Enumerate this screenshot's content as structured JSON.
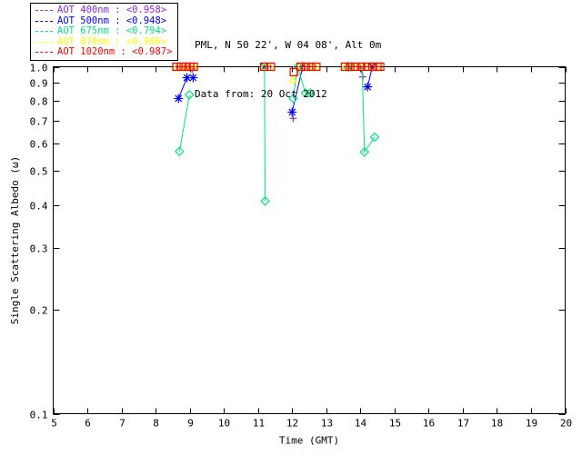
{
  "header": {
    "line1": "PML, N 50 22', W 04 08', Alt 0m",
    "line2": "Data from: 20 Oct 2012"
  },
  "legend": {
    "position": "top-left",
    "entries": [
      {
        "label": "AOT  400nm : <0.958>",
        "wavelength": "400nm",
        "mean": "<0.958>",
        "color": "#8a2be2"
      },
      {
        "label": "AOT  500nm : <0.948>",
        "wavelength": "500nm",
        "mean": "<0.948>",
        "color": "#0000ff"
      },
      {
        "label": "AOT  675nm : <0.794>",
        "wavelength": "675nm",
        "mean": "<0.794>",
        "color": "#00e67c"
      },
      {
        "label": "AOT  870nm : <0.986>",
        "wavelength": "870nm",
        "mean": "<0.986>",
        "color": "#ffff00"
      },
      {
        "label": "AOT 1020nm : <0.987>",
        "wavelength": "1020nm",
        "mean": "<0.987>",
        "color": "#ff0000"
      }
    ]
  },
  "chart_data": {
    "type": "scatter",
    "title": "",
    "xlabel": "Time (GMT)",
    "ylabel": "Single Scattering Albedo (ω)",
    "xlim": [
      5,
      20
    ],
    "ylim": [
      0.1,
      1.0
    ],
    "y_scale": "log",
    "grid": false,
    "x_ticks": [
      5,
      6,
      7,
      8,
      9,
      10,
      11,
      12,
      13,
      14,
      15,
      16,
      17,
      18,
      19,
      20
    ],
    "y_ticks": [
      0.1,
      0.2,
      0.3,
      0.4,
      0.5,
      0.6,
      0.7,
      0.8,
      0.9,
      1.0
    ],
    "axis_color": "#000000",
    "series": [
      {
        "name": "AOT 400nm",
        "color": "#8a2be2",
        "marker": "plus",
        "mean_ssa": 0.958,
        "runs": [
          [
            [
              8.62,
              1.0
            ],
            [
              8.77,
              1.0
            ],
            [
              8.91,
              1.0
            ],
            [
              9.07,
              0.985
            ]
          ],
          [
            [
              11.18,
              1.0
            ],
            [
              11.37,
              1.0
            ]
          ],
          [
            [
              12.3,
              1.0
            ],
            [
              12.45,
              1.0
            ],
            [
              12.6,
              1.0
            ]
          ],
          [
            [
              12.03,
              0.71
            ]
          ],
          [
            [
              13.6,
              1.0
            ],
            [
              13.75,
              1.0
            ]
          ],
          [
            [
              14.0,
              1.0
            ],
            [
              14.04,
              0.978
            ],
            [
              14.07,
              0.935
            ]
          ],
          [
            [
              14.3,
              1.0
            ],
            [
              14.45,
              1.0
            ]
          ]
        ]
      },
      {
        "name": "AOT 500nm",
        "color": "#0000ff",
        "marker": "asterisk",
        "mean_ssa": 0.948,
        "runs": [
          [
            [
              8.67,
              0.81
            ],
            [
              8.92,
              0.93
            ],
            [
              9.1,
              0.93
            ]
          ],
          [
            [
              11.19,
              1.0
            ]
          ],
          [
            [
              12.0,
              0.74
            ],
            [
              12.31,
              1.0
            ]
          ],
          [
            [
              13.65,
              1.0
            ]
          ],
          [
            [
              14.21,
              0.875
            ],
            [
              14.35,
              1.0
            ]
          ]
        ]
      },
      {
        "name": "AOT 675nm",
        "color": "#00e67c",
        "marker": "diamond",
        "mean_ssa": 0.794,
        "runs": [
          [
            [
              8.7,
              0.57
            ],
            [
              8.99,
              0.83
            ]
          ],
          [
            [
              11.19,
              1.0
            ],
            [
              11.21,
              0.41
            ]
          ],
          [
            [
              12.03,
              0.81
            ],
            [
              12.16,
              1.0
            ],
            [
              12.39,
              0.84
            ],
            [
              12.53,
              0.84
            ]
          ],
          [
            [
              13.6,
              1.0
            ],
            [
              13.72,
              1.0
            ]
          ],
          [
            [
              14.05,
              1.0
            ],
            [
              14.12,
              0.568
            ],
            [
              14.42,
              0.627
            ]
          ]
        ]
      },
      {
        "name": "AOT 870nm",
        "color": "#ffff00",
        "marker": "triangle",
        "mean_ssa": 0.986,
        "runs": [
          [
            [
              8.61,
              1.0
            ],
            [
              8.75,
              1.0
            ],
            [
              8.89,
              1.0
            ],
            [
              9.02,
              1.0
            ],
            [
              9.12,
              1.0
            ]
          ],
          [
            [
              11.18,
              1.0
            ],
            [
              11.37,
              1.0
            ]
          ],
          [
            [
              12.03,
              0.92
            ]
          ],
          [
            [
              12.25,
              1.0
            ],
            [
              12.4,
              1.0
            ],
            [
              12.55,
              1.0
            ],
            [
              12.7,
              1.0
            ]
          ],
          [
            [
              13.55,
              1.0
            ],
            [
              13.7,
              1.0
            ],
            [
              13.85,
              1.0
            ],
            [
              14.0,
              1.0
            ],
            [
              14.2,
              1.0
            ],
            [
              14.35,
              1.0
            ],
            [
              14.5,
              1.0
            ]
          ]
        ]
      },
      {
        "name": "AOT 1020nm",
        "color": "#ff0000",
        "marker": "square",
        "mean_ssa": 0.987,
        "runs": [
          [
            [
              8.61,
              1.0
            ],
            [
              8.75,
              1.0
            ],
            [
              8.88,
              1.0
            ],
            [
              9.01,
              1.0
            ],
            [
              9.12,
              1.0
            ]
          ],
          [
            [
              11.18,
              1.0
            ],
            [
              11.38,
              1.0
            ]
          ],
          [
            [
              12.05,
              0.965
            ]
          ],
          [
            [
              12.25,
              1.0
            ],
            [
              12.4,
              1.0
            ],
            [
              12.56,
              1.0
            ],
            [
              12.71,
              1.0
            ]
          ],
          [
            [
              13.55,
              1.0
            ],
            [
              13.7,
              1.0
            ],
            [
              13.85,
              1.0
            ],
            [
              14.02,
              1.0
            ],
            [
              14.2,
              1.0
            ],
            [
              14.35,
              1.0
            ],
            [
              14.5,
              1.0
            ],
            [
              14.58,
              1.0
            ]
          ]
        ]
      }
    ]
  }
}
